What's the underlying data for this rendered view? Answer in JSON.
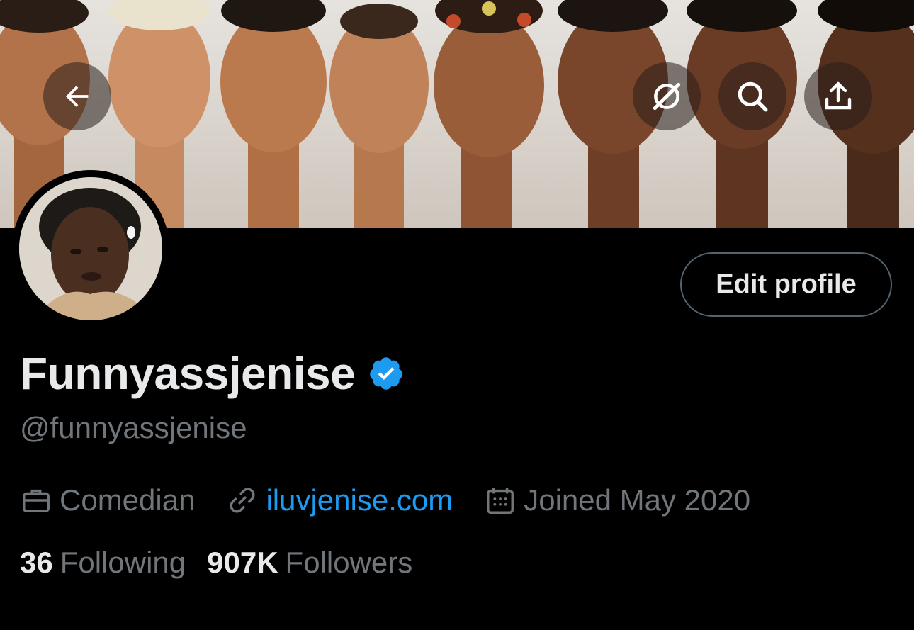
{
  "profile": {
    "display_name": "Funnyassjenise",
    "handle": "@funnyassjenise",
    "verified": true,
    "edit_label": "Edit profile",
    "profession": "Comedian",
    "website": "iluvjenise.com",
    "joined": "Joined May 2020",
    "following_count": "36",
    "following_label": "Following",
    "followers_count": "907K",
    "followers_label": "Followers"
  },
  "header_icons": [
    "back-arrow-icon",
    "grok-icon",
    "search-icon",
    "share-icon"
  ],
  "colors": {
    "background": "#000000",
    "primary_text": "#e7e9ea",
    "secondary_text": "#71767b",
    "link": "#1d9bf0",
    "verified_badge": "#1d9bf0",
    "button_border": "#536471"
  }
}
